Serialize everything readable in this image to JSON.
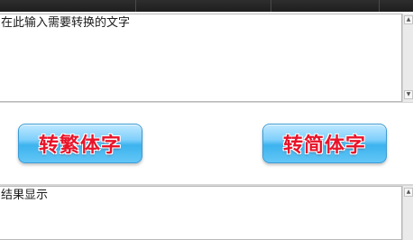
{
  "input": {
    "placeholder_text": "在此输入需要转换的文字"
  },
  "buttons": {
    "to_traditional": "转繁体字",
    "to_simplified": "转简体字"
  },
  "output": {
    "placeholder_text": "结果显示"
  },
  "scrollbar": {
    "up_arrow": "▲",
    "down_arrow": "▼"
  }
}
